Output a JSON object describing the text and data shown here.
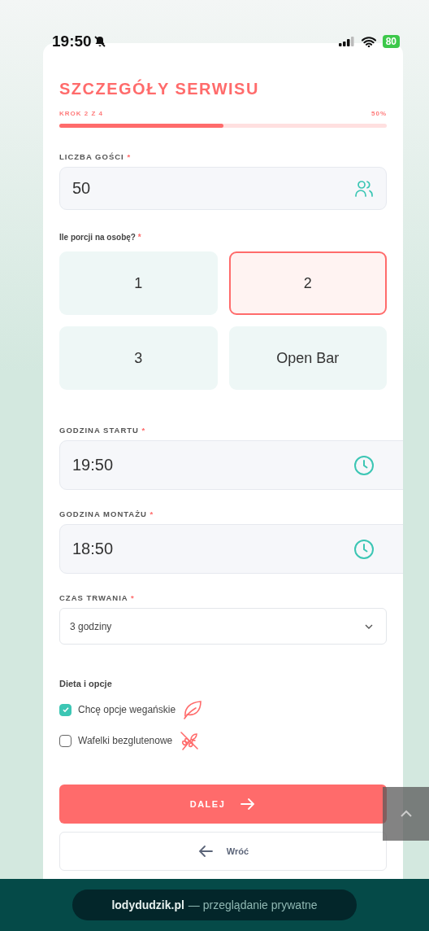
{
  "status_bar": {
    "time": "19:50",
    "battery": "80"
  },
  "form": {
    "title": "SZCZEGÓŁY SERWISU",
    "step": "KROK 2 Z 4",
    "percent": "50%",
    "level": 0.5
  },
  "guests": {
    "label": "LICZBA GOŚCI",
    "required": "*",
    "value": "50"
  },
  "portions": {
    "label": "Ile porcji na osobę?",
    "required": "*",
    "options": [
      {
        "label": "1",
        "selected": false
      },
      {
        "label": "2",
        "selected": true
      },
      {
        "label": "3",
        "selected": false
      },
      {
        "label": "Open Bar",
        "selected": false
      }
    ]
  },
  "times": [
    {
      "label": "GODZINA STARTU",
      "required": "*",
      "value": "19:50"
    },
    {
      "label": "GODZINA MONTAŻU",
      "required": "*",
      "value": "18:50"
    }
  ],
  "duration": {
    "label": "CZAS TRWANIA",
    "required": "*",
    "value": "3 godziny"
  },
  "diet": {
    "label": "Dieta i opcje",
    "options": [
      {
        "label": "Chcę opcje wegańskie",
        "checked": true,
        "kind": "leaf"
      },
      {
        "label": "Wafelki bezglutenowe",
        "checked": false,
        "kind": "wheat"
      }
    ]
  },
  "buttons": {
    "next": "DALEJ",
    "back": "Wróć"
  },
  "browser_bar": {
    "domain": "lodydudzik.pl",
    "mode": "— przeglądanie prywatne"
  }
}
